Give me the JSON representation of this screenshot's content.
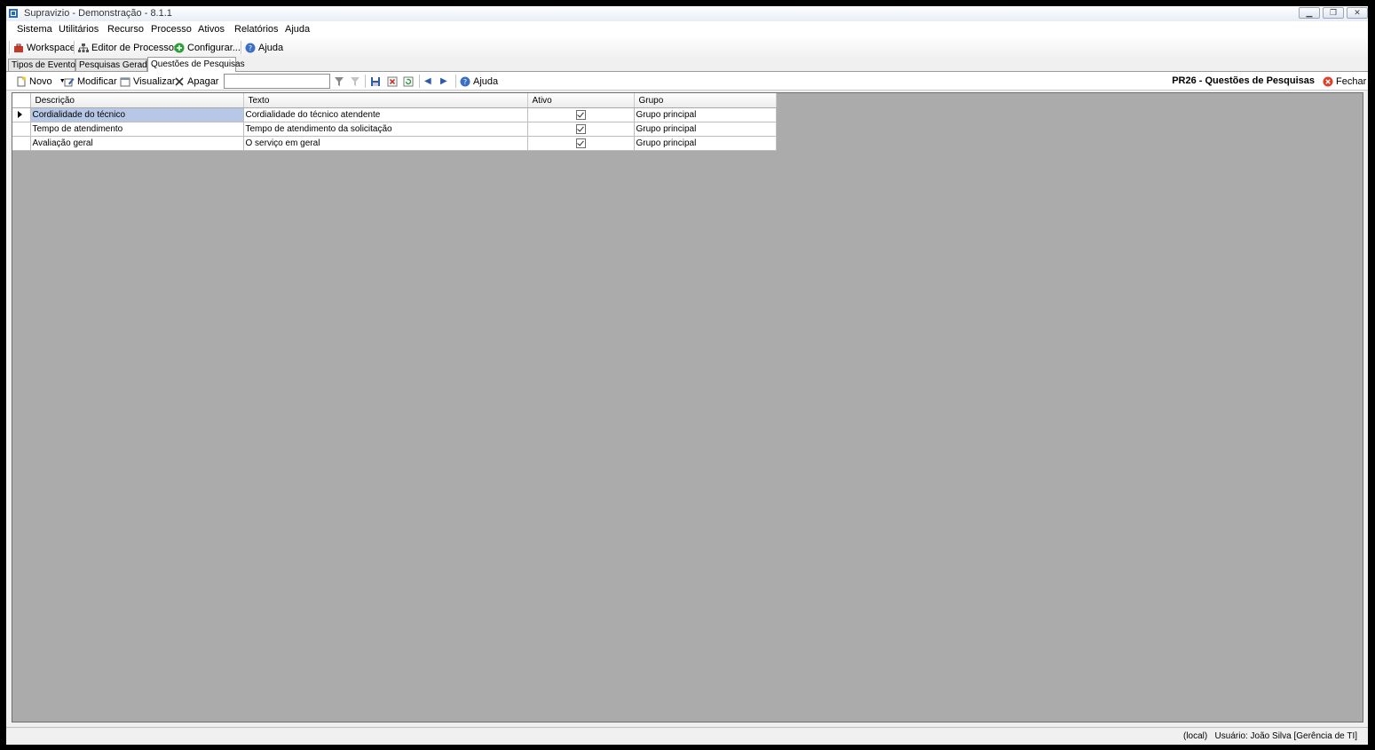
{
  "window": {
    "title": "Supravizio - Demonstração - 8.1.1"
  },
  "menu": [
    "Sistema",
    "Utilitários",
    "Recurso",
    "Processo",
    "Ativos",
    "Relatórios",
    "Ajuda"
  ],
  "main_toolbar": {
    "workspace": "Workspace",
    "editor": "Editor de Processos",
    "configurar": "Configurar...",
    "ajuda": "Ajuda"
  },
  "tabs": [
    "Tipos de Eventos",
    "Pesquisas Geradas",
    "Questões de Pesquisas"
  ],
  "screen_toolbar": {
    "novo": "Novo",
    "modificar": "Modificar",
    "visualizar": "Visualizar",
    "apagar": "Apagar",
    "filter_value": "",
    "ajuda": "Ajuda",
    "screen_title": "PR26 - Questões de Pesquisas",
    "fechar": "Fechar"
  },
  "grid": {
    "columns": [
      "Descrição",
      "Texto",
      "Ativo",
      "Grupo"
    ],
    "rows": [
      {
        "descricao": "Cordialidade do técnico",
        "texto": "Cordialidade do técnico atendente",
        "ativo": true,
        "grupo": "Grupo principal"
      },
      {
        "descricao": "Tempo de atendimento",
        "texto": "Tempo de atendimento da solicitação",
        "ativo": true,
        "grupo": "Grupo principal"
      },
      {
        "descricao": "Avaliação geral",
        "texto": "O serviço em geral",
        "ativo": true,
        "grupo": "Grupo principal"
      }
    ]
  },
  "status": {
    "text": "(local)   Usuário: João Silva [Gerência de TI]"
  },
  "colors": {
    "accent": "#b7c7e6",
    "grid_background": "#ababab"
  }
}
